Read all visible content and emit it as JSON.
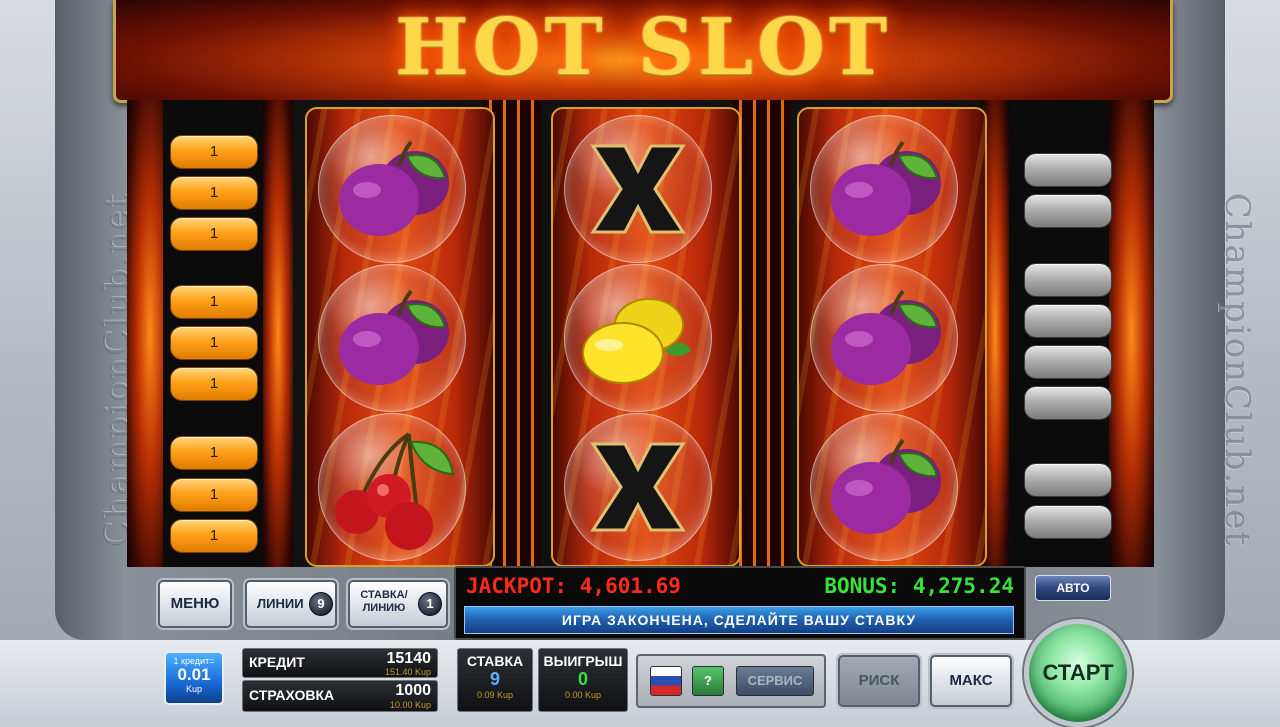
{
  "title": "HOT SLOT",
  "left_lines": [
    "1",
    "1",
    "1",
    "1",
    "1",
    "1",
    "1",
    "1",
    "1"
  ],
  "watermark_left": "ChampionClub.net",
  "watermark_right": "ChampionClub.net",
  "reels": [
    {
      "symbols": [
        "plum-icon",
        "plum-icon",
        "cherry-icon"
      ]
    },
    {
      "symbols": [
        "x-icon",
        "lemon-icon",
        "x-icon"
      ]
    },
    {
      "symbols": [
        "plum-icon",
        "plum-icon",
        "plum-icon"
      ]
    }
  ],
  "controls": {
    "menu_label": "МЕНЮ",
    "lines_label": "ЛИНИИ",
    "lines_value": "9",
    "bet_label_1": "СТАВКА/",
    "bet_label_2": "ЛИНИЮ",
    "bet_value": "1",
    "auto_label": "АВТО",
    "start_label": "СТАРТ"
  },
  "jackpot": {
    "jackpot_text": "JACKPOT: 4,601.69",
    "bonus_text": "BONUS: 4,275.24",
    "message": "ИГРА ЗАКОНЧЕНА, СДЕЛАЙТЕ ВАШУ СТАВКУ"
  },
  "bottom": {
    "denom_label": "1 кредит=",
    "denom_value": "0.01",
    "denom_unit": "Kup",
    "credit_label": "КРЕДИТ",
    "credit_value": "15140",
    "credit_sub": "151.40 Kup",
    "insurance_label": "СТРАХОВКА",
    "insurance_value": "1000",
    "insurance_sub": "10.00 Kup",
    "stake_label": "СТАВКА",
    "stake_value": "9",
    "stake_sub": "0.09 Kup",
    "win_label": "ВЫИГРЫШ",
    "win_value": "0",
    "win_sub": "0.00 Kup",
    "help_label": "?",
    "service_label": "СЕРВИС",
    "risk_label": "РИСК",
    "max_label": "МАКС"
  },
  "colors": {
    "jackpot": "#ff2a1a",
    "bonus": "#37e23a",
    "title": "#ffd84a"
  }
}
